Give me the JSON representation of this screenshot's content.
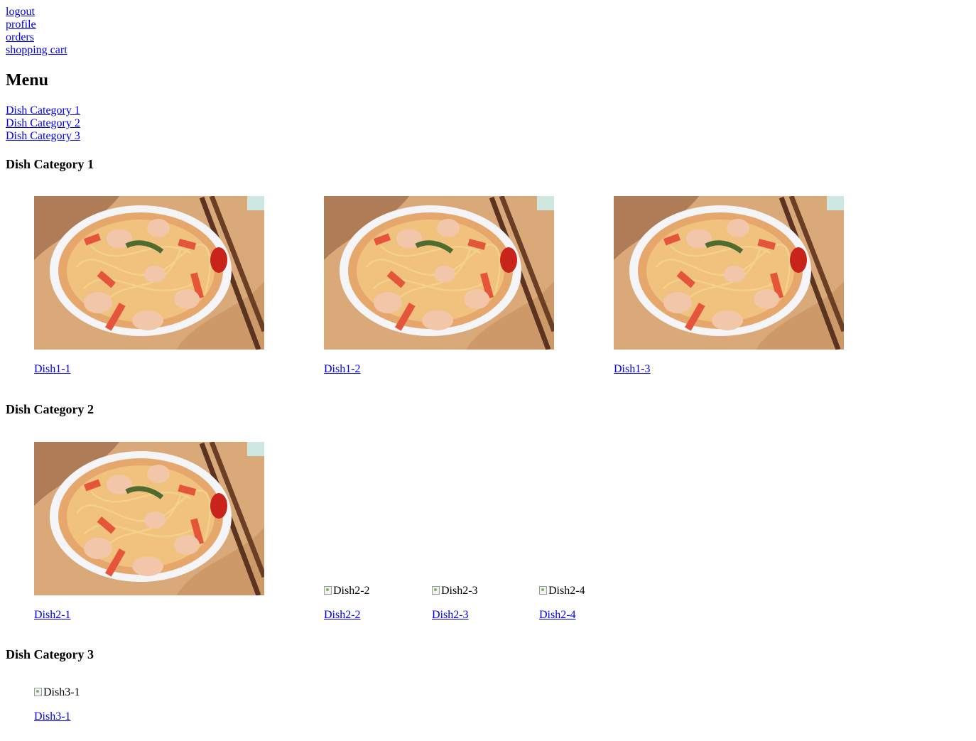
{
  "nav": {
    "logout": "logout",
    "profile": "profile",
    "orders": "orders",
    "cart": "shopping cart"
  },
  "menu": {
    "title": "Menu",
    "category_links": [
      "Dish Category 1",
      "Dish Category 2",
      "Dish Category 3"
    ]
  },
  "categories": [
    {
      "title": "Dish Category 1",
      "dishes": [
        {
          "name": "Dish1-1",
          "alt": "Dish1-1"
        },
        {
          "name": "Dish1-2",
          "alt": "Dish1-2"
        },
        {
          "name": "Dish1-3",
          "alt": "Dish1-3"
        }
      ]
    },
    {
      "title": "Dish Category 2",
      "dishes": [
        {
          "name": "Dish2-1",
          "alt": "Dish2-1"
        },
        {
          "name": "Dish2-2",
          "alt": "Dish2-2"
        },
        {
          "name": "Dish2-3",
          "alt": "Dish2-3"
        },
        {
          "name": "Dish2-4",
          "alt": "Dish2-4"
        }
      ]
    },
    {
      "title": "Dish Category 3",
      "dishes": [
        {
          "name": "Dish3-1",
          "alt": "Dish3-1"
        }
      ]
    }
  ],
  "colors": {
    "link": "#0000ee",
    "text": "#000000"
  }
}
